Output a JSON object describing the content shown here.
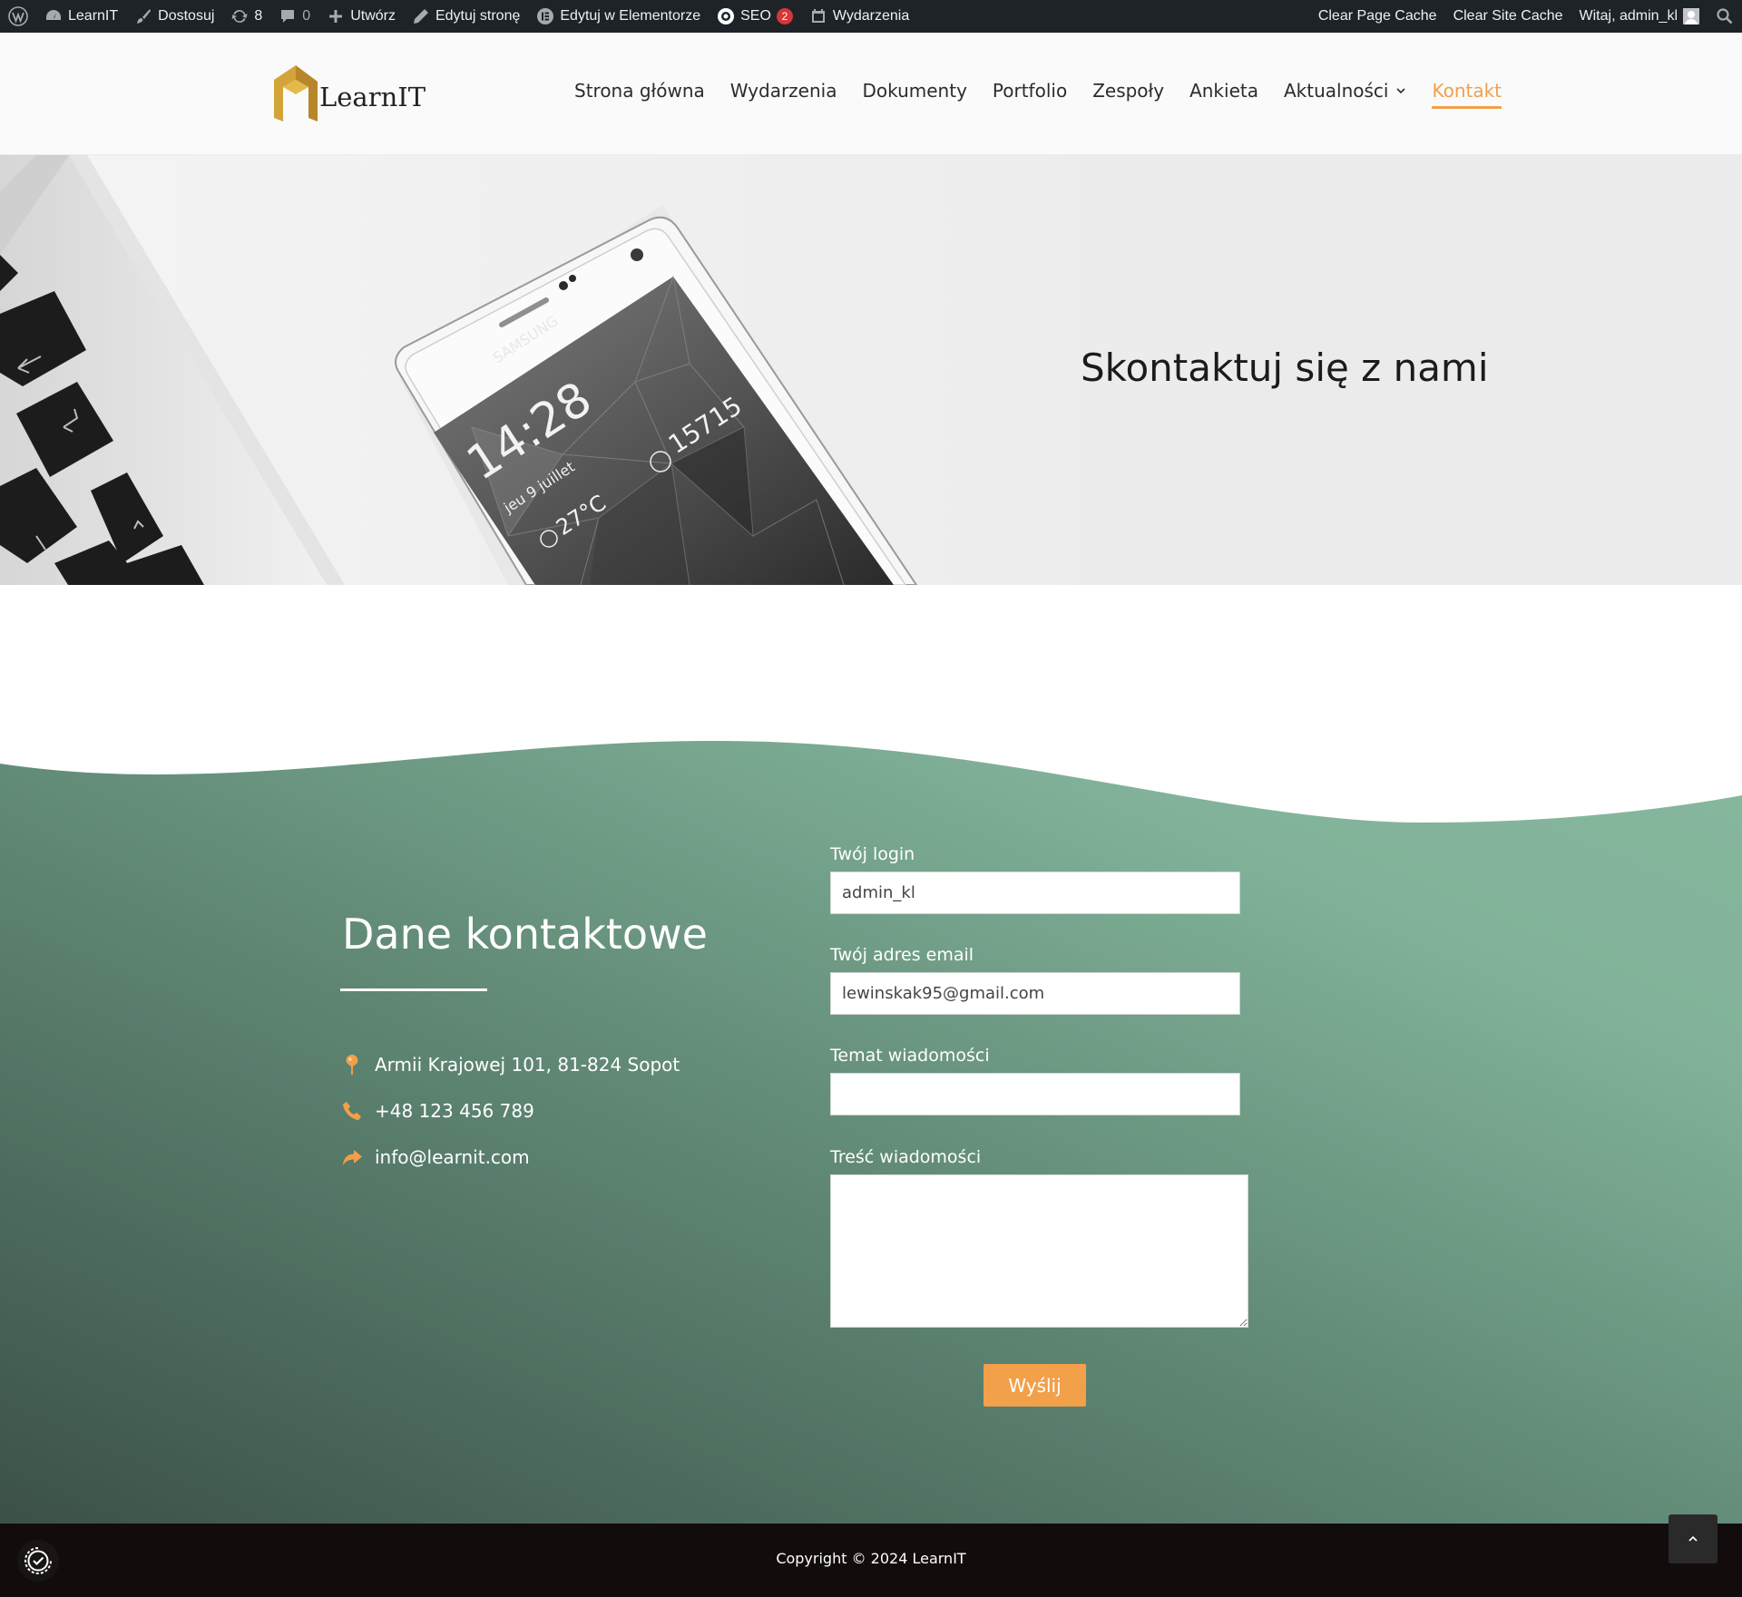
{
  "admin_bar": {
    "site_name": "LearnIT",
    "customize": "Dostosuj",
    "updates_count": "8",
    "comments_count": "0",
    "new": "Utwórz",
    "edit_page": "Edytuj stronę",
    "edit_elementor": "Edytuj w Elementorze",
    "seo": "SEO",
    "seo_badge": "2",
    "events": "Wydarzenia",
    "clear_page_cache": "Clear Page Cache",
    "clear_site_cache": "Clear Site Cache",
    "greeting": "Witaj, admin_kl"
  },
  "header": {
    "logo_text": "LearnIT",
    "nav": [
      {
        "label": "Strona główna"
      },
      {
        "label": "Wydarzenia"
      },
      {
        "label": "Dokumenty"
      },
      {
        "label": "Portfolio"
      },
      {
        "label": "Zespoły"
      },
      {
        "label": "Ankieta"
      },
      {
        "label": "Aktualności"
      },
      {
        "label": "Kontakt"
      }
    ],
    "active_item": "Kontakt"
  },
  "hero": {
    "title": "Skontaktuj się z nami",
    "phone_time": "14:28",
    "phone_date": "jeu 9 juillet",
    "phone_temp": "27°C",
    "phone_steps": "15715",
    "phone_brand": "SAMSUNG"
  },
  "contact": {
    "title": "Dane kontaktowe",
    "address": "Armii Krajowej 101, 81-824 Sopot",
    "phone": "+48 123 456 789",
    "email": "info@learnit.com",
    "form": {
      "login_label": "Twój login",
      "login_value": "admin_kl",
      "email_label": "Twój adres email",
      "email_value": "lewinskak95@gmail.com",
      "subject_label": "Temat wiadomości",
      "subject_value": "",
      "message_label": "Treść wiadomości",
      "message_value": "",
      "submit_label": "Wyślij"
    }
  },
  "footer": {
    "copyright": "Copyright © 2024 LearnIT"
  },
  "colors": {
    "accent": "#f0a04b",
    "admin_bar": "#1d2327",
    "green_light": "#84b89d",
    "green_dark": "#3e5449",
    "footer": "#120c0c"
  },
  "icons": [
    "wordpress-icon",
    "dashboard-icon",
    "brush-icon",
    "updates-icon",
    "comments-icon",
    "plus-icon",
    "pencil-icon",
    "elementor-icon",
    "seo-gear-icon",
    "calendar-icon",
    "avatar-icon",
    "search-icon",
    "chevron-down-icon",
    "map-pin-icon",
    "phone-icon",
    "share-arrow-icon",
    "cookie-consent-icon",
    "chevron-up-icon"
  ]
}
